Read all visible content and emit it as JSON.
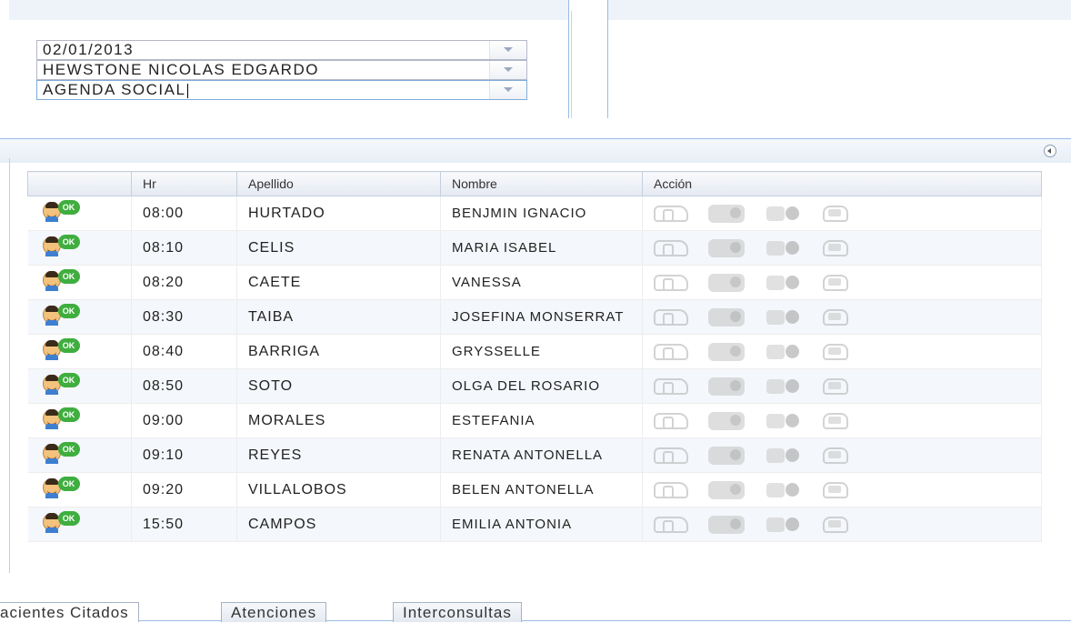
{
  "filters": {
    "fecha": "02/01/2013",
    "profesional": "HEWSTONE NICOLAS EDGARDO",
    "agenda": "AGENDA SOCIAL"
  },
  "grid": {
    "columns": [
      "",
      "Hr",
      "Apellido",
      "Nombre",
      "Acción"
    ],
    "status_badge": "OK",
    "rows": [
      {
        "hr": "08:00",
        "apellido": "HURTADO",
        "nombre": "BENJMIN IGNACIO"
      },
      {
        "hr": "08:10",
        "apellido": "CELIS",
        "nombre": "MARIA ISABEL"
      },
      {
        "hr": "08:20",
        "apellido": "CAETE",
        "nombre": "VANESSA"
      },
      {
        "hr": "08:30",
        "apellido": "TAIBA",
        "nombre": "JOSEFINA MONSERRAT"
      },
      {
        "hr": "08:40",
        "apellido": "BARRIGA",
        "nombre": "GRYSSELLE"
      },
      {
        "hr": "08:50",
        "apellido": "SOTO",
        "nombre": "OLGA DEL ROSARIO"
      },
      {
        "hr": "09:00",
        "apellido": "MORALES",
        "nombre": "ESTEFANIA"
      },
      {
        "hr": "09:10",
        "apellido": "REYES",
        "nombre": "RENATA ANTONELLA"
      },
      {
        "hr": "09:20",
        "apellido": "VILLALOBOS",
        "nombre": "BELEN ANTONELLA"
      },
      {
        "hr": "15:50",
        "apellido": "CAMPOS",
        "nombre": "EMILIA ANTONIA"
      }
    ],
    "action_icons": [
      "call-patient-icon",
      "attend-icon",
      "cancel-icon",
      "absent-hand-icon"
    ]
  },
  "tabs": [
    {
      "label": "acientes Citados",
      "active": true
    },
    {
      "label": "Atenciones",
      "active": false
    },
    {
      "label": "Interconsultas",
      "active": false
    }
  ],
  "colors": {
    "border": "#99bbe8",
    "header_bg": "#e4e9f2",
    "ok_badge": "#3fae3f"
  }
}
